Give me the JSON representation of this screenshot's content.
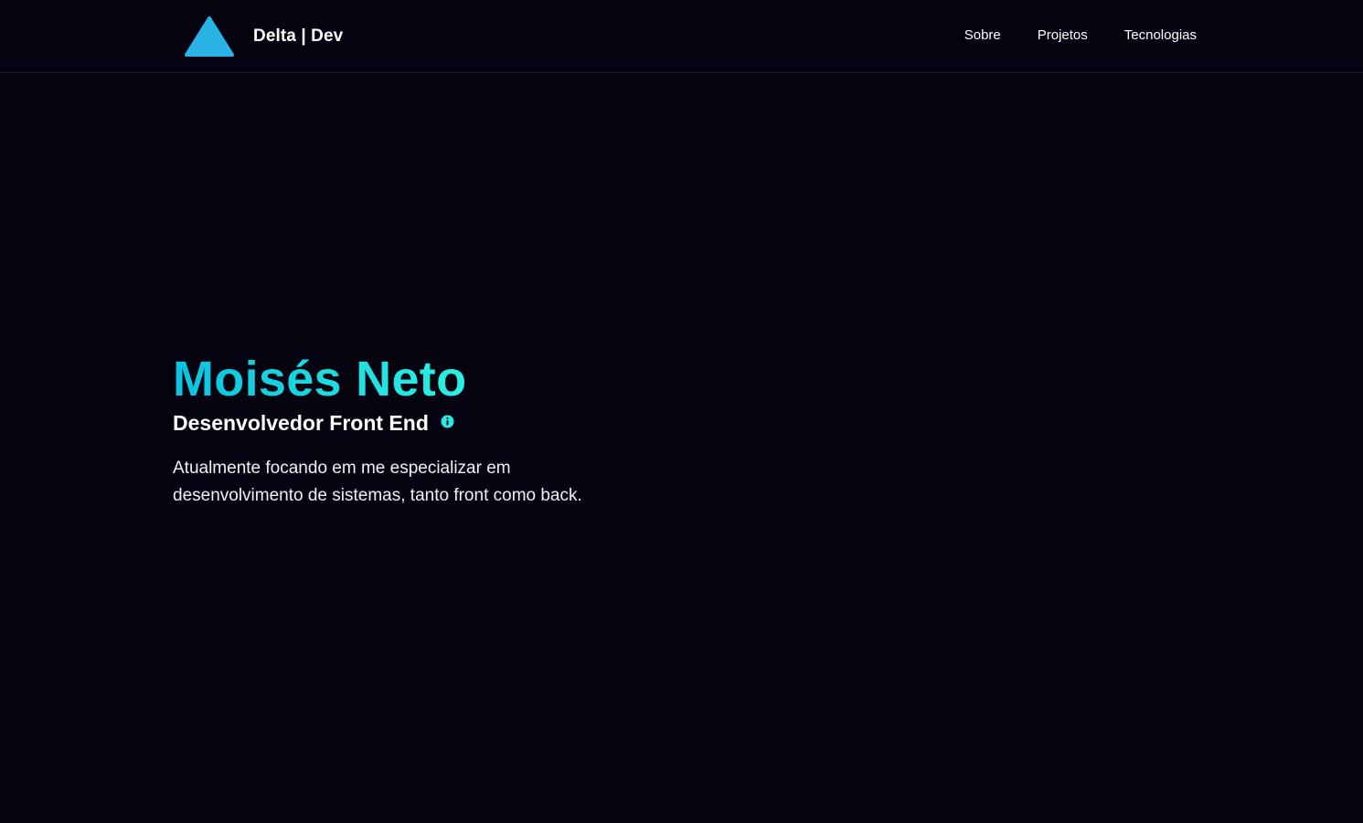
{
  "header": {
    "brand": "Delta | Dev",
    "logo_icon": "triangle-logo-icon",
    "nav": [
      {
        "label": "Sobre"
      },
      {
        "label": "Projetos"
      },
      {
        "label": "Tecnologias"
      }
    ]
  },
  "hero": {
    "name": "Moisés Neto",
    "role": "Desenvolvedor Front End",
    "info_icon": "info-icon",
    "description": "Atualmente focando em me especializar em desenvolvimento de sistemas, tanto front como back."
  },
  "colors": {
    "background": "#04030f",
    "accent_start": "#09c3e0",
    "accent_end": "#2df0e0",
    "logo": "#29b3e6"
  }
}
